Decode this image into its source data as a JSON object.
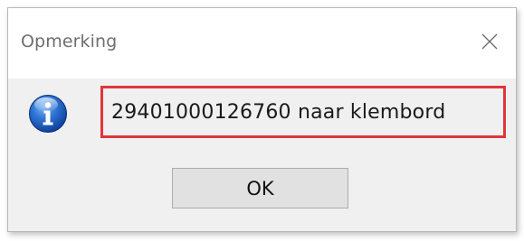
{
  "dialog": {
    "title": "Opmerking",
    "close_icon": "close-icon",
    "info_icon": "info-icon",
    "message": "29401000126760 naar klembord",
    "ok_label": "OK",
    "highlight_color": "#e0363a"
  }
}
